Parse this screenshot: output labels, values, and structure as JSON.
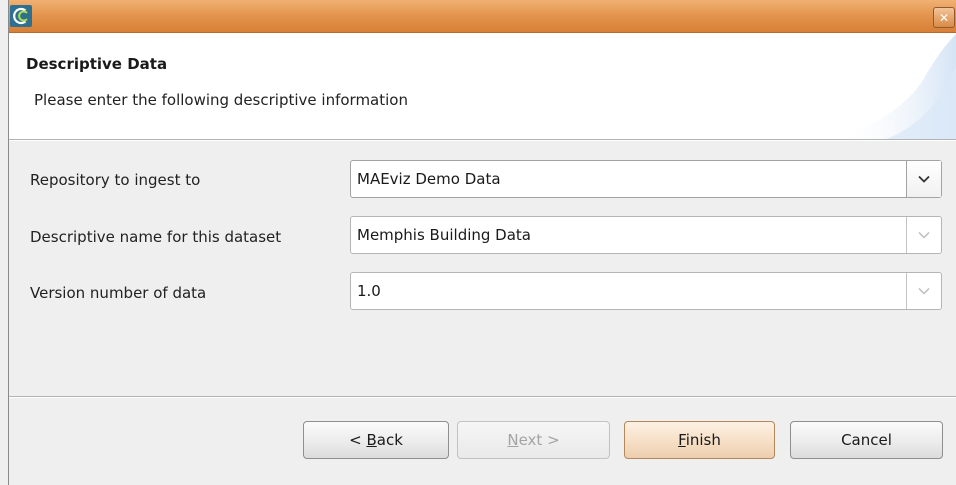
{
  "window": {
    "close_glyph": "✕"
  },
  "header": {
    "title": "Descriptive Data",
    "description": "Please enter the following descriptive information"
  },
  "form": {
    "fields": [
      {
        "label": "Repository to ingest to",
        "value": "MAEviz Demo Data",
        "dropdown_enabled": true
      },
      {
        "label": "Descriptive name for this dataset",
        "value": "Memphis Building Data",
        "dropdown_enabled": false
      },
      {
        "label": "Version number of data",
        "value": "1.0",
        "dropdown_enabled": false
      }
    ]
  },
  "buttons": {
    "back": {
      "prefix": "< ",
      "mnemonic": "B",
      "rest": "ack",
      "enabled": true
    },
    "next": {
      "prefix": "",
      "mnemonic": "N",
      "rest": "ext >",
      "enabled": false
    },
    "finish": {
      "prefix": "",
      "mnemonic": "F",
      "rest": "inish",
      "enabled": true,
      "default": true
    },
    "cancel": {
      "label": "Cancel",
      "enabled": true
    }
  },
  "icons": {
    "app": "app-logo-icon",
    "close": "close-icon",
    "dropdown": "chevron-down-icon"
  },
  "colors": {
    "titlebar": "#e49650",
    "default_button": "#f6dfc6"
  }
}
